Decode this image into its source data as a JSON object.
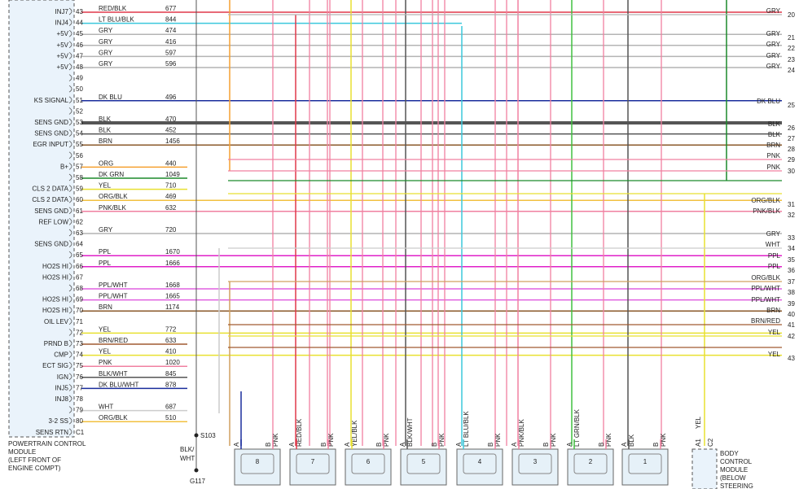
{
  "pcm": {
    "title_lines": [
      "POWERTRAIN CONTROL",
      "MODULE",
      "(LEFT FRONT OF",
      "ENGINE COMPT)"
    ],
    "pins": [
      {
        "pin": "43",
        "label": "INJ7",
        "color_code": "RED/BLK",
        "circuit": "677",
        "wire": "#e0384a",
        "to": 20,
        "drop": "x363"
      },
      {
        "pin": "44",
        "label": "INJ4",
        "color_code": "LT BLU/BLK",
        "circuit": "844",
        "wire": "#3bc8dc",
        "drop": "x567"
      },
      {
        "pin": "45",
        "label": "+5V",
        "color_code": "GRY",
        "circuit": "474",
        "wire": "#b4b4b4",
        "to": 21
      },
      {
        "pin": "46",
        "label": "+5V",
        "color_code": "GRY",
        "circuit": "416",
        "wire": "#b4b4b4",
        "to": 22
      },
      {
        "pin": "47",
        "label": "+5V",
        "color_code": "GRY",
        "circuit": "597",
        "wire": "#b4b4b4",
        "to": 23
      },
      {
        "pin": "48",
        "label": "+5V",
        "color_code": "GRY",
        "circuit": "596",
        "wire": "#b4b4b4",
        "to": 24
      },
      {
        "pin": "49",
        "label": "",
        "color_code": "",
        "circuit": ""
      },
      {
        "pin": "50",
        "label": "",
        "color_code": "",
        "circuit": ""
      },
      {
        "pin": "51",
        "label": "KS SIGNAL",
        "color_code": "DK BLU",
        "circuit": "496",
        "wire": "#1a2d9c",
        "to": 25
      },
      {
        "pin": "52",
        "label": "",
        "color_code": "",
        "circuit": ""
      },
      {
        "pin": "53",
        "label": "SENS GND",
        "color_code": "BLK",
        "circuit": "470",
        "wire": "#555555",
        "to": 26
      },
      {
        "pin": "54",
        "label": "SENS GND",
        "color_code": "BLK",
        "circuit": "452",
        "wire": "#555555",
        "to": 27
      },
      {
        "pin": "55",
        "label": "EGR INPUT",
        "color_code": "BRN",
        "circuit": "1456",
        "wire": "#8b5a2b",
        "to": 28
      },
      {
        "pin": "56",
        "label": "",
        "color_code": "",
        "circuit": ""
      },
      {
        "pin": "57",
        "label": "B+",
        "color_code": "ORG",
        "circuit": "440",
        "wire": "#f5a030"
      },
      {
        "pin": "58",
        "label": "",
        "color_code": "DK GRN",
        "circuit": "1049",
        "wire": "#1b8a2a"
      },
      {
        "pin": "59",
        "label": "CLS 2 DATA",
        "color_code": "YEL",
        "circuit": "710",
        "wire": "#e8e030"
      },
      {
        "pin": "60",
        "label": "CLS 2 DATA",
        "color_code": "ORG/BLK",
        "circuit": "469",
        "wire": "#f2c040",
        "to": 31
      },
      {
        "pin": "61",
        "label": "SENS GND",
        "color_code": "PNK/BLK",
        "circuit": "632",
        "wire": "#f080a0",
        "to": 32
      },
      {
        "pin": "62",
        "label": "REF LOW",
        "color_code": "",
        "circuit": ""
      },
      {
        "pin": "63",
        "label": "",
        "color_code": "GRY",
        "circuit": "720",
        "wire": "#b4b4b4",
        "to": 33
      },
      {
        "pin": "64",
        "label": "SENS GND",
        "color_code": "",
        "circuit": ""
      },
      {
        "pin": "65",
        "label": "",
        "color_code": "PPL",
        "circuit": "1670",
        "wire": "#e020c8",
        "to": 35
      },
      {
        "pin": "66",
        "label": "HO2S HI",
        "color_code": "PPL",
        "circuit": "1666",
        "wire": "#e020c8",
        "to": 36
      },
      {
        "pin": "67",
        "label": "HO2S HI",
        "color_code": "",
        "circuit": ""
      },
      {
        "pin": "68",
        "label": "",
        "color_code": "PPL/WHT",
        "circuit": "1668",
        "wire": "#e060e0",
        "to": 38
      },
      {
        "pin": "69",
        "label": "HO2S HI",
        "color_code": "PPL/WHT",
        "circuit": "1665",
        "wire": "#e060e0",
        "to": 39
      },
      {
        "pin": "70",
        "label": "HO2S HI",
        "color_code": "BRN",
        "circuit": "1174",
        "wire": "#8b5a2b",
        "to": 40
      },
      {
        "pin": "71",
        "label": "OIL LEV",
        "color_code": "",
        "circuit": ""
      },
      {
        "pin": "72",
        "label": "",
        "color_code": "YEL",
        "circuit": "772",
        "wire": "#e8e030",
        "to": 42
      },
      {
        "pin": "73",
        "label": "PRND B",
        "color_code": "BRN/RED",
        "circuit": "633",
        "wire": "#a05a30"
      },
      {
        "pin": "74",
        "label": "CMP",
        "color_code": "YEL",
        "circuit": "410",
        "wire": "#e8e030",
        "to": 43
      },
      {
        "pin": "75",
        "label": "ECT SIG",
        "color_code": "PNK",
        "circuit": "1020",
        "wire": "#f080a0"
      },
      {
        "pin": "76",
        "label": "IGN",
        "color_code": "BLK/WHT",
        "circuit": "845",
        "wire": "#555555"
      },
      {
        "pin": "77",
        "label": "INJ5",
        "color_code": "DK BLU/WHT",
        "circuit": "878",
        "wire": "#1a2d9c"
      },
      {
        "pin": "78",
        "label": "INJ8",
        "color_code": "",
        "circuit": ""
      },
      {
        "pin": "79",
        "label": "",
        "color_code": "WHT",
        "circuit": "687",
        "wire": "#cccccc"
      },
      {
        "pin": "80",
        "label": "3-2 SS",
        "color_code": "ORG/BLK",
        "circuit": "510",
        "wire": "#f2c040"
      },
      {
        "pin": "C1",
        "label": "SENS RTN",
        "color_code": "",
        "circuit": ""
      }
    ]
  },
  "right_terminals": [
    {
      "num": "20",
      "label": "GRY"
    },
    {
      "num": "21",
      "label": "GRY"
    },
    {
      "num": "22",
      "label": "GRY"
    },
    {
      "num": "23",
      "label": "GRY"
    },
    {
      "num": "24",
      "label": "GRY"
    },
    {
      "num": "25",
      "label": "DK BLU"
    },
    {
      "num": "26",
      "label": "BLK"
    },
    {
      "num": "27",
      "label": "BLK"
    },
    {
      "num": "28",
      "label": "BRN"
    },
    {
      "num": "29",
      "label": "PNK"
    },
    {
      "num": "30",
      "label": "PNK"
    },
    {
      "num": "31",
      "label": "ORG/BLK"
    },
    {
      "num": "32",
      "label": "PNK/BLK"
    },
    {
      "num": "33",
      "label": "GRY"
    },
    {
      "num": "34",
      "label": "WHT"
    },
    {
      "num": "35",
      "label": "PPL"
    },
    {
      "num": "36",
      "label": "PPL"
    },
    {
      "num": "37",
      "label": "ORG/BLK"
    },
    {
      "num": "38",
      "label": "PPL/WHT"
    },
    {
      "num": "39",
      "label": "PPL/WHT"
    },
    {
      "num": "40",
      "label": "BRN"
    },
    {
      "num": "41",
      "label": "BRN/RED"
    },
    {
      "num": "42",
      "label": "YEL"
    },
    {
      "num": "43",
      "label": "YEL"
    }
  ],
  "splice": {
    "label": "S103",
    "wire_code": [
      "BLK/",
      "WHT"
    ],
    "ground": "G117"
  },
  "injectors": [
    {
      "num": "8",
      "pin_a": "A",
      "pin_b": "B",
      "a_label": "",
      "b_label": "PNK",
      "a_color": "#1a2d9c",
      "b_color": "#f080a0"
    },
    {
      "num": "7",
      "pin_a": "A",
      "pin_b": "B",
      "a_label": "RED/BLK",
      "b_label": "PNK",
      "a_color": "#e0384a",
      "b_color": "#f080a0"
    },
    {
      "num": "6",
      "pin_a": "A",
      "pin_b": "B",
      "a_label": "YEL/BLK",
      "b_label": "PNK",
      "a_color": "#e8e030",
      "b_color": "#f080a0"
    },
    {
      "num": "5",
      "pin_a": "A",
      "pin_b": "B",
      "a_label": "BLK/WHT",
      "b_label": "PNK",
      "a_color": "#555555",
      "b_color": "#f080a0"
    },
    {
      "num": "4",
      "pin_a": "A",
      "pin_b": "B",
      "a_label": "LT BLU/BLK",
      "b_label": "PNK",
      "a_color": "#3bc8dc",
      "b_color": "#f080a0"
    },
    {
      "num": "3",
      "pin_a": "A",
      "pin_b": "B",
      "a_label": "PNK/BLK",
      "b_label": "PNK",
      "a_color": "#f080a0",
      "b_color": "#f080a0"
    },
    {
      "num": "2",
      "pin_a": "A",
      "pin_b": "B",
      "a_label": "LT GRN/BLK",
      "b_label": "PNK",
      "a_color": "#40c040",
      "b_color": "#f080a0"
    },
    {
      "num": "1",
      "pin_a": "A",
      "pin_b": "B",
      "a_label": "BLK",
      "b_label": "PNK",
      "a_color": "#555555",
      "b_color": "#f080a0"
    }
  ],
  "bcm": {
    "title_lines": [
      "BODY",
      "CONTROL",
      "MODULE",
      "(BELOW",
      "STEERING"
    ],
    "pin_a1": "A1",
    "pin_c2": "C2",
    "wire_label": "YEL"
  }
}
